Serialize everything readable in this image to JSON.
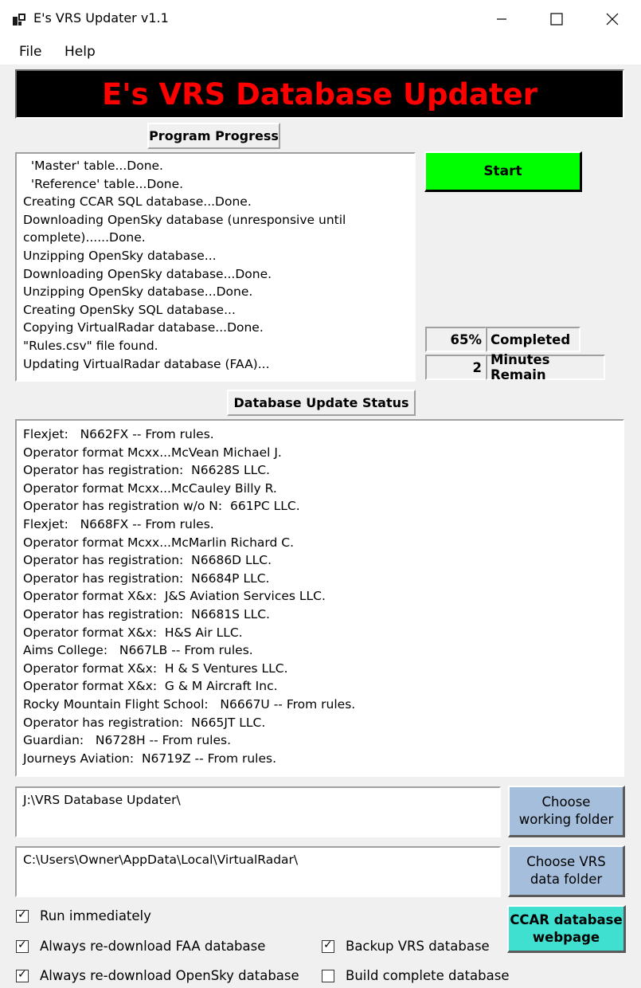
{
  "window": {
    "title": "E's VRS Updater v1.1",
    "app_icon": "app-window-icon",
    "controls": [
      "minimize-icon",
      "maximize-icon",
      "close-icon"
    ]
  },
  "menu": {
    "file": "File",
    "help": "Help"
  },
  "banner": {
    "text": "E's VRS Database Updater",
    "color": "#ff0000",
    "background": "#000000"
  },
  "progress": {
    "label": "Program Progress",
    "log": [
      "  'Master' table...Done.",
      "  'Reference' table...Done.",
      "Creating CCAR SQL database...Done.",
      "Downloading OpenSky database (unresponsive until",
      "complete)......Done.",
      "Unzipping OpenSky database...",
      "Downloading OpenSky database...Done.",
      "Unzipping OpenSky database...Done.",
      "Creating OpenSky SQL database...",
      "Copying VirtualRadar database...Done.",
      "\"Rules.csv\" file found.",
      "Updating VirtualRadar database (FAA)..."
    ],
    "start_label": "Start",
    "start_color": "#00ff00",
    "percent": "65%",
    "percent_label": "Completed",
    "minutes": "2",
    "minutes_label": "Minutes Remain"
  },
  "status": {
    "label": "Database Update Status",
    "log": [
      "Flexjet:   N662FX -- From rules.",
      "Operator format Mcxx...McVean Michael J.",
      "Operator has registration:  N6628S LLC.",
      "Operator format Mcxx...McCauley Billy R.",
      "Operator has registration w/o N:  661PC LLC.",
      "Flexjet:   N668FX -- From rules.",
      "Operator format Mcxx...McMarlin Richard C.",
      "Operator has registration:  N6686D LLC.",
      "Operator has registration:  N6684P LLC.",
      "Operator format X&x:  J&S Aviation Services LLC.",
      "Operator has registration:  N6681S LLC.",
      "Operator format X&x:  H&S Air LLC.",
      "Aims College:   N667LB -- From rules.",
      "Operator format X&x:  H & S Ventures LLC.",
      "Operator format X&x:  G & M Aircraft Inc.",
      "Rocky Mountain Flight School:   N6667U -- From rules.",
      "Operator has registration:  N665JT LLC.",
      "Guardian:   N6728H -- From rules.",
      "Journeys Aviation:  N6719Z -- From rules."
    ]
  },
  "folders": {
    "working": "J:\\VRS Database Updater\\",
    "working_button_1": "Choose",
    "working_button_2": "working folder",
    "vrs": "C:\\Users\\Owner\\AppData\\Local\\VirtualRadar\\",
    "vrs_button_1": "Choose VRS",
    "vrs_button_2": "data folder",
    "button_color": "#a4bedc"
  },
  "ccar": {
    "line1": "CCAR database",
    "line2": "webpage",
    "color": "#40e0d0"
  },
  "options": {
    "run_immediately": {
      "label": "Run immediately",
      "checked": true
    },
    "redownload_faa": {
      "label": "Always re-download FAA database",
      "checked": true
    },
    "redownload_opensky": {
      "label": "Always re-download OpenSky database",
      "checked": true
    },
    "backup_vrs": {
      "label": "Backup VRS database",
      "checked": true
    },
    "build_complete": {
      "label": "Build complete database",
      "checked": false
    }
  }
}
